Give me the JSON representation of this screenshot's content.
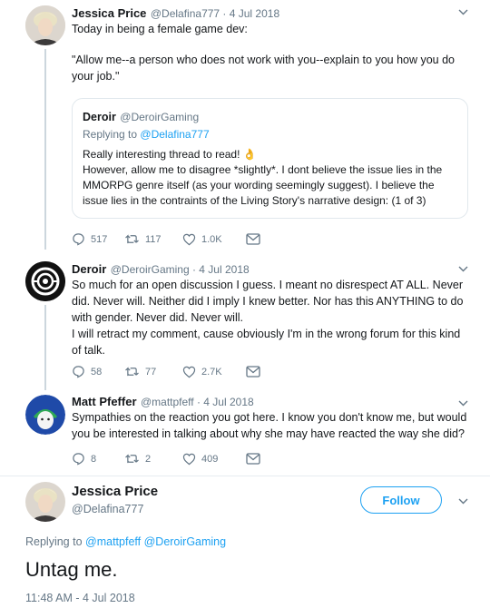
{
  "tweet1": {
    "name": "Jessica Price",
    "handle": "@Delafina777 · 4 Jul 2018",
    "line1": "Today in being a female game dev:",
    "line2": "\"Allow me--a person who does not work with you--explain to you how you do your job.\"",
    "quote": {
      "name": "Deroir",
      "handle": "@DeroirGaming",
      "replying_label": "Replying to",
      "replying_handle": "@Delafina777",
      "text1": "Really interesting thread to read! 👌",
      "text2": "However, allow me to disagree *slightly*. I dont believe the issue lies in the MMORPG genre itself (as your wording seemingly suggest). I believe the issue lies in the contraints of the Living Story's narrative design: (1 of 3)"
    },
    "actions": {
      "replies": "517",
      "retweets": "117",
      "likes": "1.0K"
    }
  },
  "tweet2": {
    "name": "Deroir",
    "handle": "@DeroirGaming · 4 Jul 2018",
    "text": "So much for an open discussion I guess. I meant no disrespect AT ALL. Never did. Never will. Neither did I imply I knew better. Nor has this ANYTHING to do with gender. Never did. Never will.\nI will retract my comment, cause obviously I'm in the wrong forum for this kind of talk.",
    "actions": {
      "replies": "58",
      "retweets": "77",
      "likes": "2.7K"
    }
  },
  "tweet3": {
    "name": "Matt Pfeffer",
    "handle": "@mattpfeff · 4 Jul 2018",
    "text": "Sympathies on the reaction you got here. I know you don't know me, but would you be interested in talking about why she may have reacted the way she did?",
    "actions": {
      "replies": "8",
      "retweets": "2",
      "likes": "409"
    }
  },
  "main": {
    "name": "Jessica Price",
    "handle": "@Delafina777",
    "follow_label": "Follow",
    "replying_label": "Replying to",
    "replying_handles": "@mattpfeff @DeroirGaming",
    "text": "Untag me.",
    "timestamp": "11:48 AM - 4 Jul 2018"
  },
  "colors": {
    "accent": "#1da1f2",
    "muted": "#657786",
    "line": "#ccd6dd"
  }
}
